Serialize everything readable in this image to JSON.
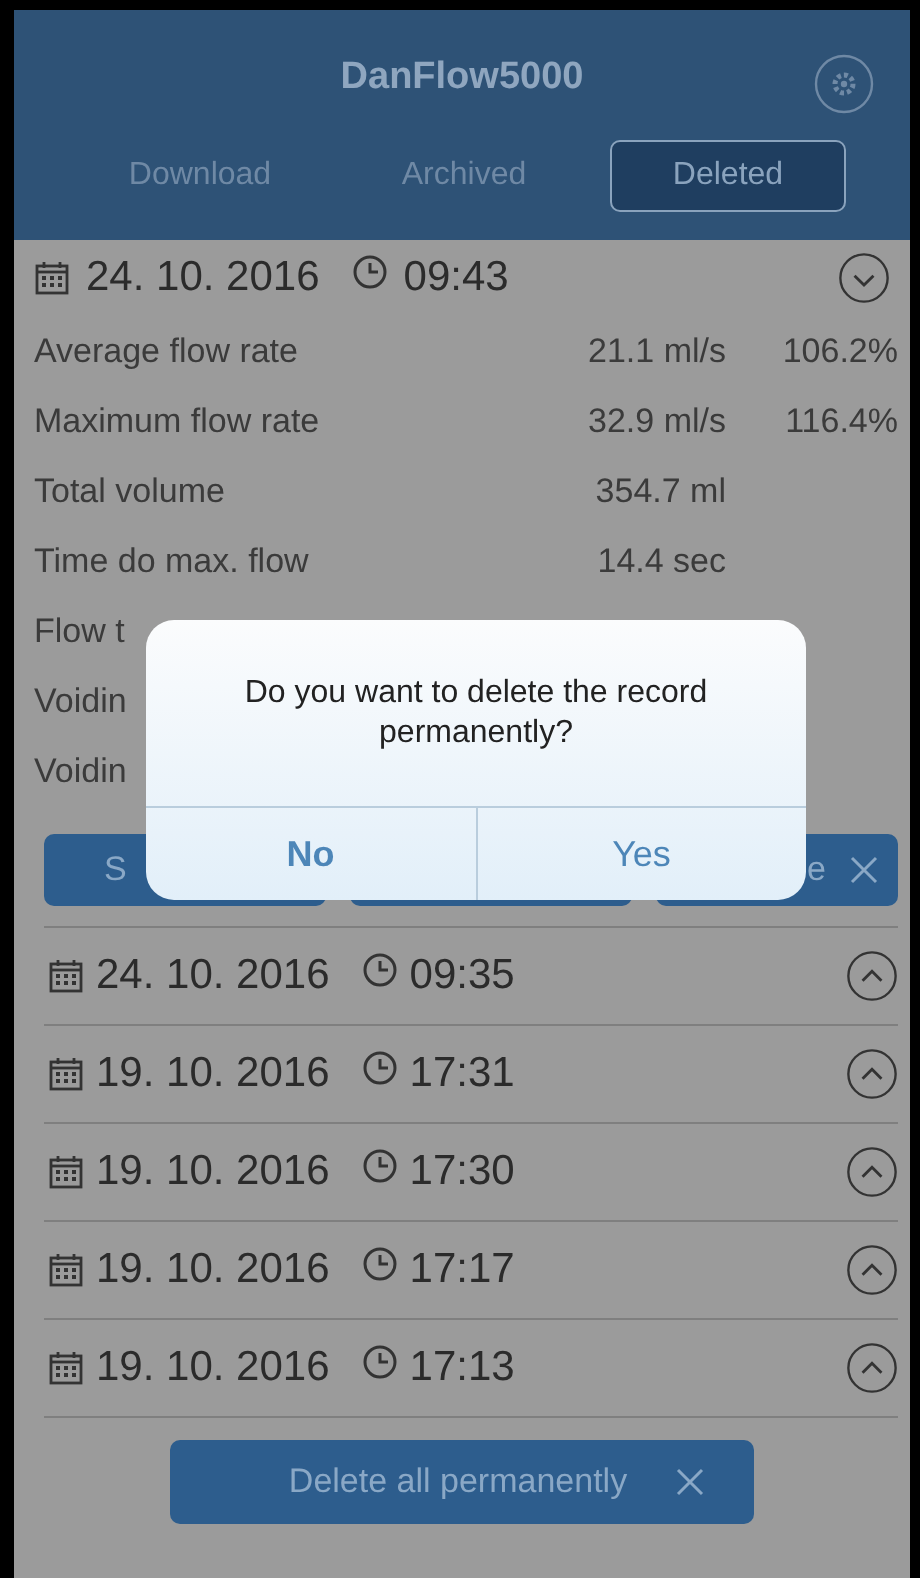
{
  "app": {
    "title": "DanFlow5000"
  },
  "tabs": [
    {
      "label": "Download",
      "selected": false
    },
    {
      "label": "Archived",
      "selected": false
    },
    {
      "label": "Deleted",
      "selected": true
    }
  ],
  "expanded_record": {
    "date": "24. 10. 2016",
    "time": "09:43",
    "expanded": true,
    "details": [
      {
        "label": "Average flow rate",
        "value": "21.1 ml/s",
        "percent": "106.2%"
      },
      {
        "label": "Maximum flow rate",
        "value": "32.9 ml/s",
        "percent": "116.4%"
      },
      {
        "label": "Total volume",
        "value": "354.7 ml"
      },
      {
        "label": "Time do max. flow",
        "value": "14.4 sec"
      },
      {
        "label": "Flow t"
      },
      {
        "label": "Voidin"
      },
      {
        "label": "Voidin"
      }
    ],
    "actions": [
      {
        "kind": "plain",
        "label": "S"
      },
      {
        "kind": "plain"
      },
      {
        "kind": "delete",
        "label": "e"
      }
    ]
  },
  "records": [
    {
      "date": "24. 10. 2016",
      "time": "09:35",
      "expanded": false
    },
    {
      "date": "19. 10. 2016",
      "time": "17:31",
      "expanded": false
    },
    {
      "date": "19. 10. 2016",
      "time": "17:30",
      "expanded": false
    },
    {
      "date": "19. 10. 2016",
      "time": "17:17",
      "expanded": false
    },
    {
      "date": "19. 10. 2016",
      "time": "17:13",
      "expanded": false
    }
  ],
  "delete_all_button": {
    "label": "Delete all permanently"
  },
  "dialog": {
    "message": "Do you want to delete the record permanently?",
    "buttons": [
      "No",
      "Yes"
    ]
  }
}
